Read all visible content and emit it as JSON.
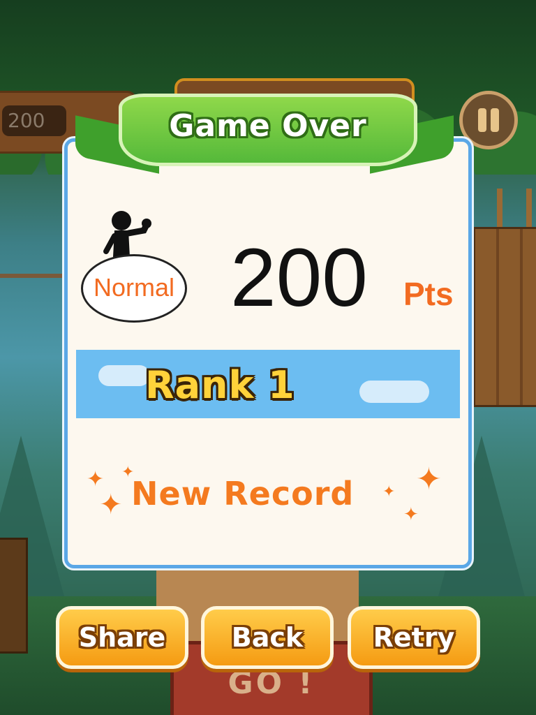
{
  "hud": {
    "score_value": "200",
    "pause_icon": "pause-icon"
  },
  "background": {
    "go_text": "GO !"
  },
  "dialog": {
    "title": "Game Over",
    "mode_label": "Normal",
    "score_value": "200",
    "score_unit": "Pts",
    "rank_label": "Rank 1",
    "record_label": "New Record"
  },
  "buttons": {
    "share_label": "Share",
    "back_label": "Back",
    "retry_label": "Retry"
  },
  "colors": {
    "accent_orange": "#f26b21",
    "ribbon_green": "#55b93a",
    "rank_band_blue": "#6cbdf1",
    "button_orange": "#f59b12"
  }
}
